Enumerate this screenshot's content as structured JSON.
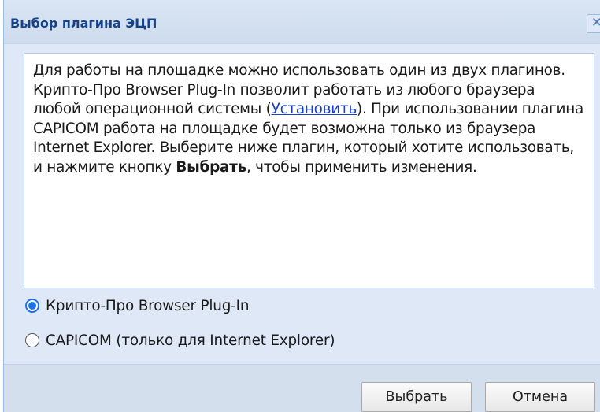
{
  "dialog": {
    "title": "Выбор плагина ЭЦП",
    "close_label": "✕"
  },
  "info": {
    "text_part1": "Для работы на площадке можно использовать один из двух плагинов. Крипто-Про Browser Plug-In позволит работать из любого браузера любой операционной системы (",
    "install_link": "Установить",
    "text_part2": "). При использовании плагина CAPICOM работа на площадке будет возможна только из браузера Internet Explorer. Выберите ниже плагин, который хотите использовать, и нажмите кнопку ",
    "bold_word": "Выбрать",
    "text_part3": ", чтобы применить изменения."
  },
  "options": [
    {
      "label": "Крипто-Про Browser Plug-In",
      "checked": true
    },
    {
      "label": "CAPICOM (только для Internet Explorer)",
      "checked": false
    }
  ],
  "buttons": {
    "select_label": "Выбрать",
    "cancel_label": "Отмена"
  },
  "colors": {
    "title_text": "#15428b",
    "dialog_bg": "#dfe8f6",
    "link": "#1a3fc7",
    "radio_accent": "#1a73e8"
  }
}
